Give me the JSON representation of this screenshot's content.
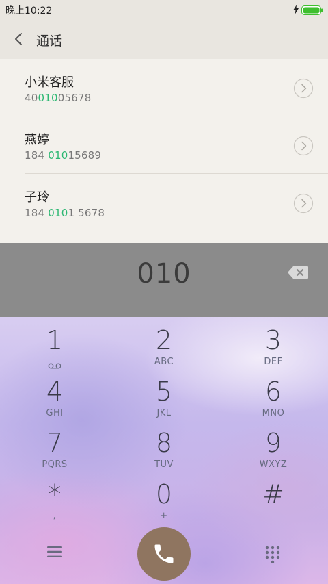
{
  "status_bar": {
    "time": "晚上10:22",
    "battery_color": "#3fbf2f"
  },
  "header": {
    "title": "通话"
  },
  "contacts": [
    {
      "name": "小米客服",
      "number_pre": "40",
      "number_match": "010",
      "number_post": "05678"
    },
    {
      "name": "燕婷",
      "number_pre": "184 ",
      "number_match": "010",
      "number_post": "15689"
    },
    {
      "name": "子玲",
      "number_pre": "184 ",
      "number_match": "010",
      "number_post": "1 5678"
    }
  ],
  "dialer": {
    "input": "010"
  },
  "keypad": {
    "keys": [
      {
        "digit": "1",
        "letters": ""
      },
      {
        "digit": "2",
        "letters": "ABC"
      },
      {
        "digit": "3",
        "letters": "DEF"
      },
      {
        "digit": "4",
        "letters": "GHI"
      },
      {
        "digit": "5",
        "letters": "JKL"
      },
      {
        "digit": "6",
        "letters": "MNO"
      },
      {
        "digit": "7",
        "letters": "PQRS"
      },
      {
        "digit": "8",
        "letters": "TUV"
      },
      {
        "digit": "9",
        "letters": "WXYZ"
      },
      {
        "digit": "*",
        "letters": ","
      },
      {
        "digit": "0",
        "letters": "+"
      },
      {
        "digit": "#",
        "letters": ""
      }
    ]
  },
  "icons": {
    "back": "chevron-left-icon",
    "detail": "chevron-right-circle-icon",
    "backspace": "backspace-icon",
    "voicemail": "voicemail-icon",
    "menu": "menu-icon",
    "call": "phone-icon",
    "dialpad": "dialpad-icon",
    "charging": "lightning-icon",
    "battery": "battery-icon"
  },
  "colors": {
    "highlight": "#2db873",
    "call_button": "#8f7560"
  }
}
